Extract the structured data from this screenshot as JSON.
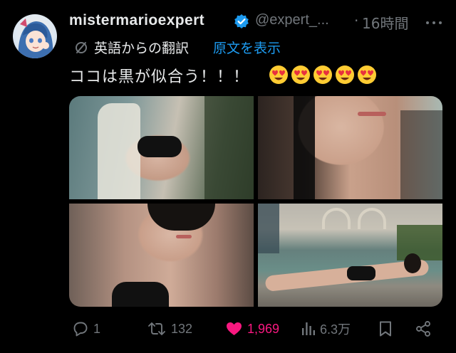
{
  "post": {
    "display_name": "mistermarioexpert",
    "handle": "@expert_...",
    "separator": "·",
    "time": "16時間",
    "translation_label": "英語からの翻訳",
    "translation_link": "原文を表示",
    "text": "ココは黒が似合う！！！",
    "emoji_icon": "heart-eyes-emoji",
    "emoji_count": 5
  },
  "actions": {
    "replies": "1",
    "reposts": "132",
    "likes": "1,969",
    "views": "6.3万"
  },
  "colors": {
    "background": "#000000",
    "text": "#e7e9ea",
    "muted": "#71767b",
    "link": "#1d9bf0",
    "like": "#f91880",
    "verified": "#1d9bf0"
  },
  "icons": {
    "reply": "reply-icon",
    "repost": "repost-icon",
    "like": "heart-icon",
    "views": "views-bar-chart-icon",
    "bookmark": "bookmark-icon",
    "share": "share-icon",
    "more": "more-dots-icon",
    "verified": "verified-badge-icon",
    "translate": "translate-icon"
  }
}
